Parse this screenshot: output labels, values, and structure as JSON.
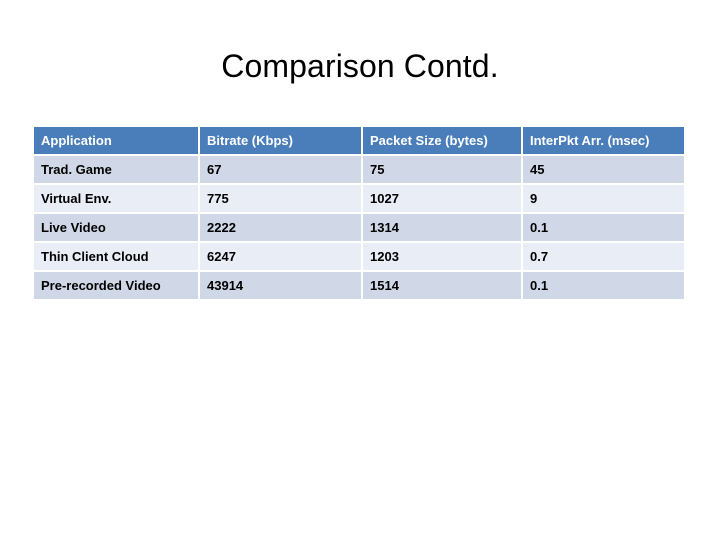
{
  "slide": {
    "title": "Comparison Contd."
  },
  "table": {
    "headers": [
      "Application",
      "Bitrate (Kbps)",
      "Packet Size (bytes)",
      "InterPkt Arr. (msec)"
    ],
    "rows": [
      {
        "application": "Trad. Game",
        "bitrate": "67",
        "packet_size": "75",
        "interpkt_arrival": "45"
      },
      {
        "application": "Virtual Env.",
        "bitrate": "775",
        "packet_size": "1027",
        "interpkt_arrival": "9"
      },
      {
        "application": "Live Video",
        "bitrate": "2222",
        "packet_size": "1314",
        "interpkt_arrival": "0.1"
      },
      {
        "application": "Thin Client Cloud",
        "bitrate": "6247",
        "packet_size": "1203",
        "interpkt_arrival": "0.7"
      },
      {
        "application": "Pre-recorded Video",
        "bitrate": "43914",
        "packet_size": "1514",
        "interpkt_arrival": "0.1"
      }
    ]
  },
  "colors": {
    "header_background": "#4a7ebb",
    "header_text": "#ffffff",
    "row_odd_background": "#d0d8e8",
    "row_even_background": "#e9edf5",
    "body_text": "#000000",
    "slide_background": "#ffffff"
  }
}
